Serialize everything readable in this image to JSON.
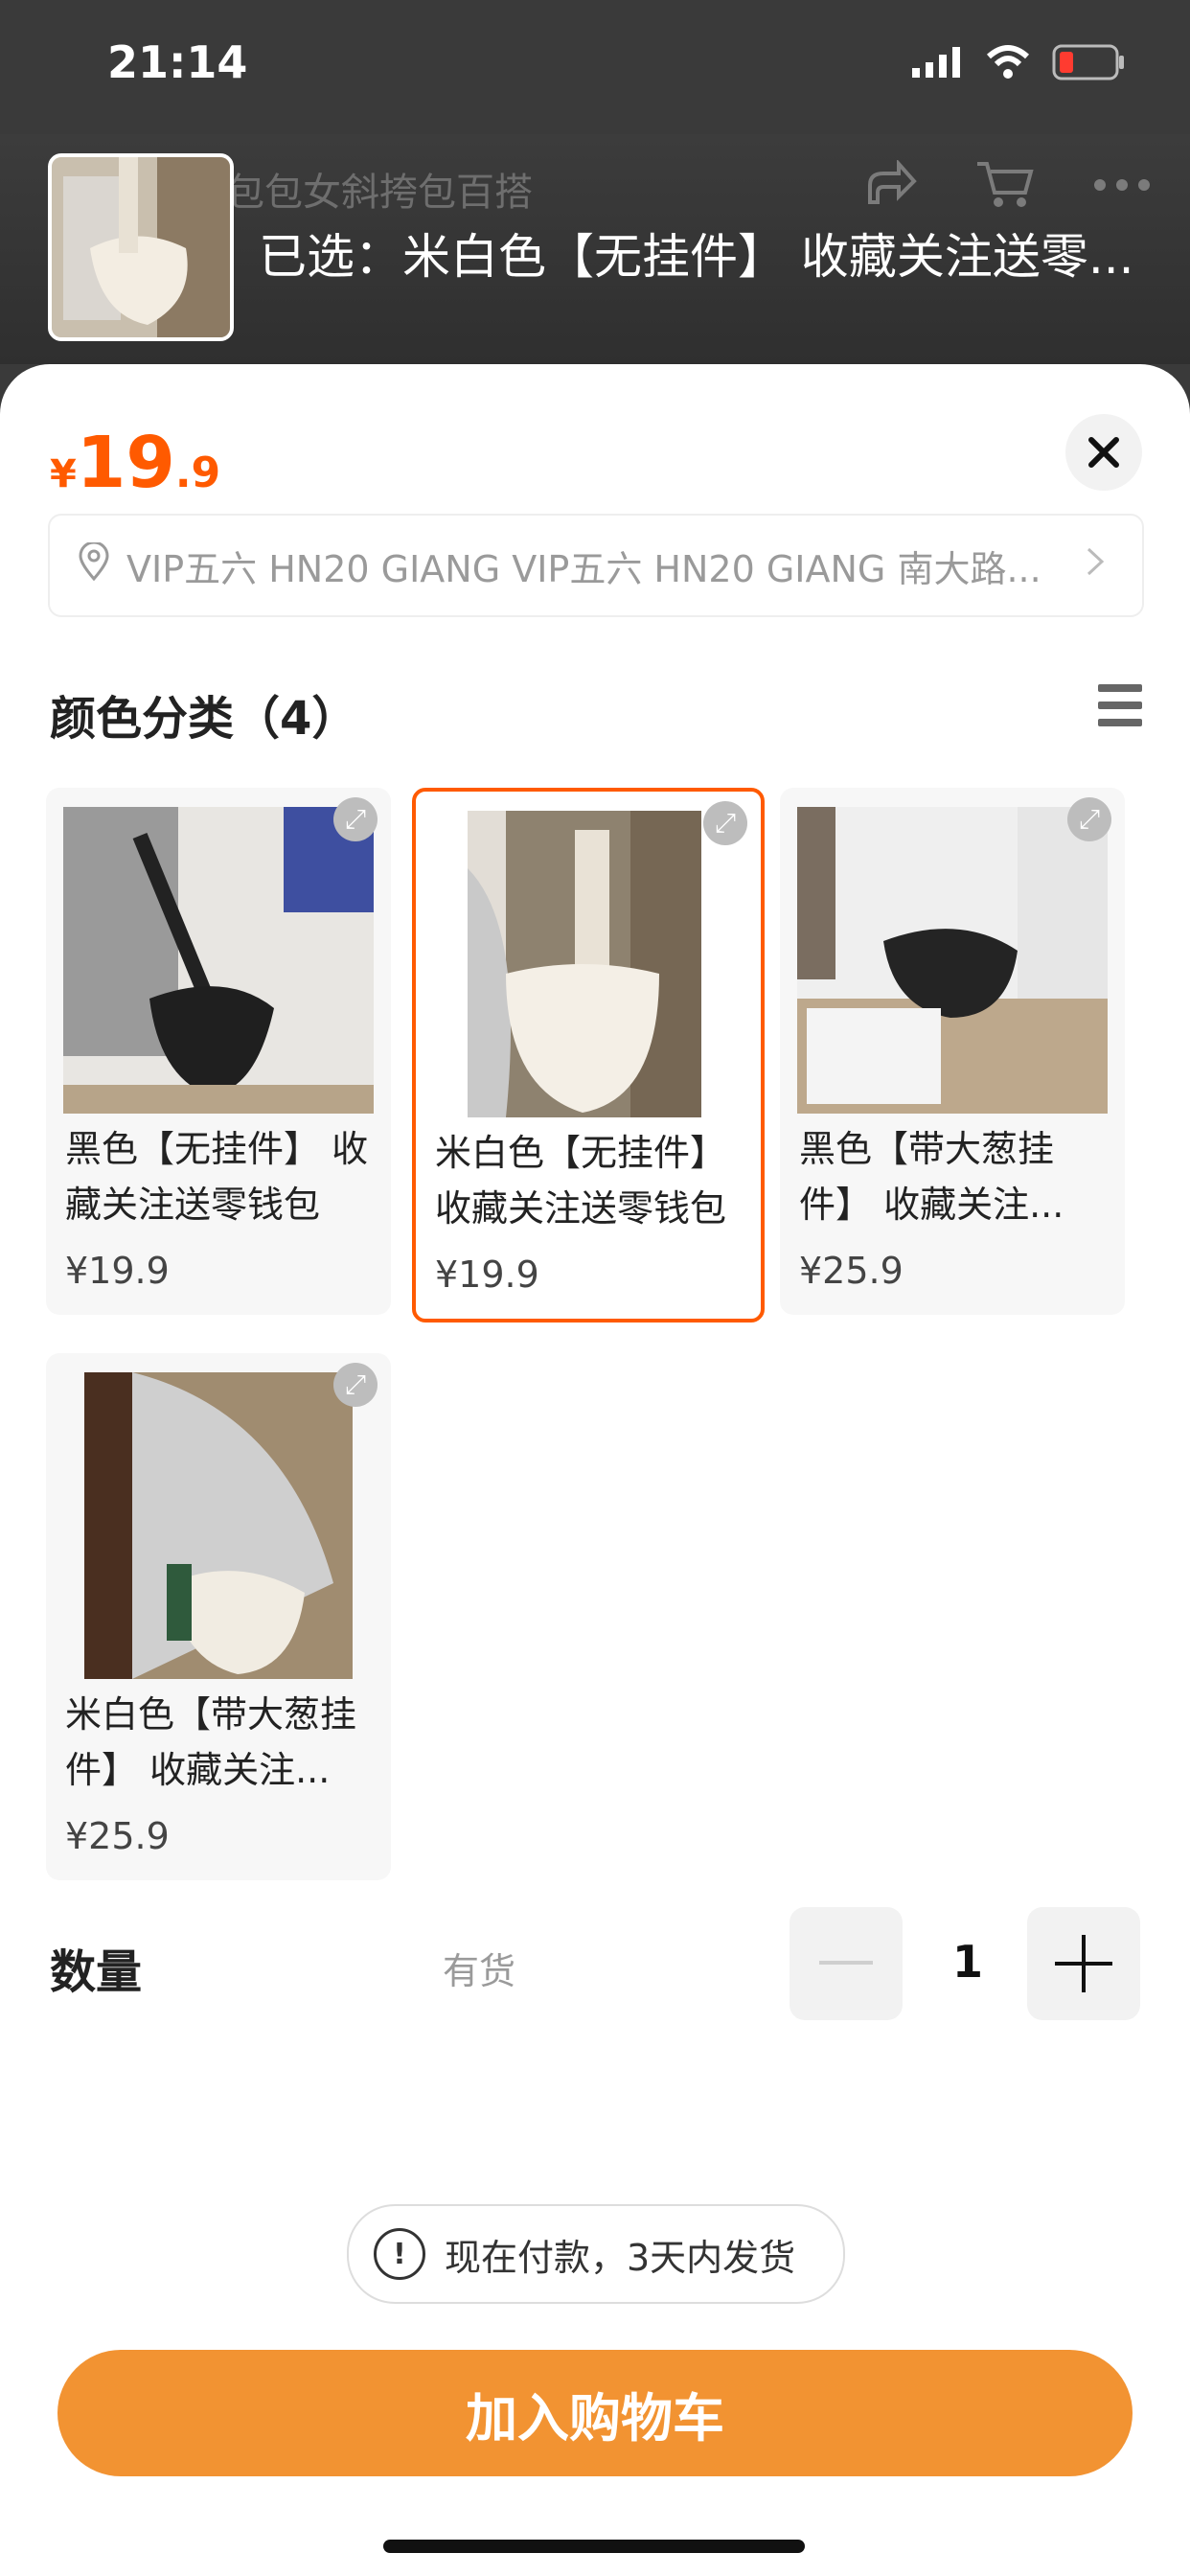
{
  "status": {
    "time": "21:14"
  },
  "header": {
    "thumb_alt": "product-thumbnail",
    "backdrop_title": "包包女斜挎包百搭",
    "selected_text": "已选：米白色【无挂件】 收藏关注送零..."
  },
  "sheet": {
    "price_symbol": "¥",
    "price_int": "19",
    "price_dec": ".9",
    "address": "VIP五六 HN20 GIANG VIP五六 HN20 GIANG 南大路...",
    "section_title": "颜色分类（4）",
    "variants": [
      {
        "name": "黑色【无挂件】 收藏关注送零钱包",
        "price": "¥19.9",
        "color": "#2a2a2a"
      },
      {
        "name": "米白色【无挂件】 收藏关注送零钱包",
        "price": "¥19.9",
        "color": "#e9e0d0"
      },
      {
        "name": "黑色【带大葱挂件】 收藏关注...",
        "price": "¥25.9",
        "color": "#2b2b2b"
      },
      {
        "name": "米白色【带大葱挂件】 收藏关注...",
        "price": "¥25.9",
        "color": "#efe9de"
      }
    ],
    "quantity_label": "数量",
    "stock_label": "有货",
    "quantity_value": "1",
    "notice": "现在付款，3天内发货",
    "add_to_cart": "加入购物车"
  },
  "colors": {
    "accent": "#ff5a00",
    "button": "#f29332"
  }
}
